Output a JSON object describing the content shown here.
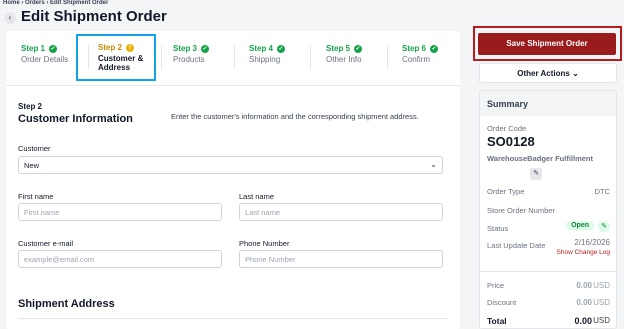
{
  "breadcrumb": "Home › Orders › Edit Shipment Order",
  "title": "Edit Shipment Order",
  "steps": [
    {
      "num": "Step 1",
      "label": "Order Details",
      "state": "done"
    },
    {
      "num": "Step 2",
      "label": "Customer & Address",
      "state": "active"
    },
    {
      "num": "Step 3",
      "label": "Products",
      "state": "done"
    },
    {
      "num": "Step 4",
      "label": "Shipping",
      "state": "done"
    },
    {
      "num": "Step 5",
      "label": "Other Info",
      "state": "done"
    },
    {
      "num": "Step 6",
      "label": "Confirm",
      "state": "done"
    }
  ],
  "section": {
    "step": "Step 2",
    "title": "Customer Information",
    "description": "Enter the customer's information and the corresponding shipment address."
  },
  "form": {
    "customer_label": "Customer",
    "customer_value": "New",
    "first_name_label": "First name",
    "first_name_placeholder": "First name",
    "last_name_label": "Last name",
    "last_name_placeholder": "Last name",
    "email_label": "Customer e-mail",
    "email_placeholder": "example@email.com",
    "phone_label": "Phone Number",
    "phone_placeholder": "Phone Number"
  },
  "shipment_title": "Shipment Address",
  "actions": {
    "save": "Save Shipment Order",
    "other": "Other Actions"
  },
  "summary": {
    "heading": "Summary",
    "order_code_label": "Order Code",
    "order_code": "SO0128",
    "fulfillment": "WarehouseBadger Fulfillment",
    "order_type_label": "Order Type",
    "order_type": "DTC",
    "store_order_label": "Store Order Number",
    "status_label": "Status",
    "status": "Open",
    "last_update_label": "Last Update Date",
    "last_update": "2/16/2026",
    "change_log": "Show Change Log",
    "price_label": "Price",
    "price": "0.00",
    "discount_label": "Discount",
    "discount": "0.00",
    "total_label": "Total",
    "total": "0.00",
    "currency": "USD"
  },
  "colors": {
    "accent_red": "#991b1b",
    "step_done": "#16a34a",
    "step_active_border": "#0ea5e9",
    "status_green": "#15803d"
  }
}
